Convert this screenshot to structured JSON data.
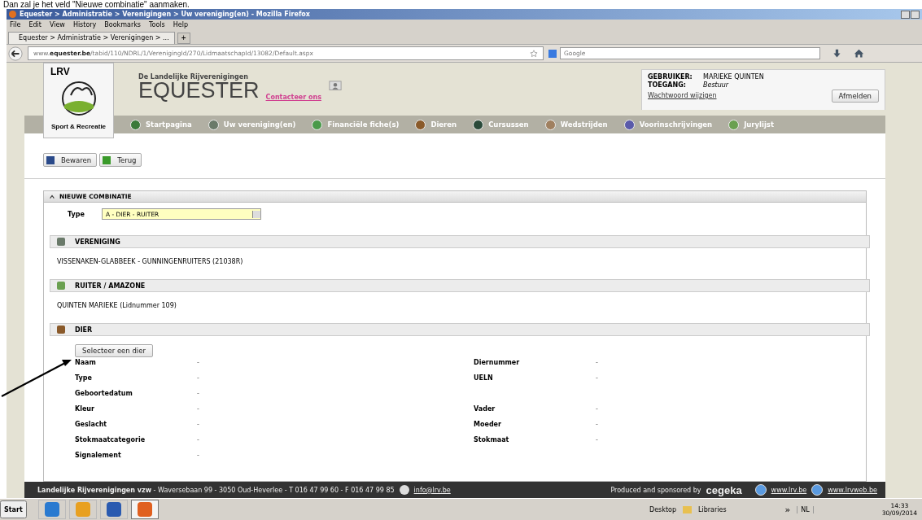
{
  "caption": "Dan zal je het veld \"Nieuwe combinatie\" aanmaken.",
  "window": {
    "title": "Equester > Administratie > Verenigingen > Uw vereniging(en) - Mozilla Firefox"
  },
  "menu": [
    "File",
    "Edit",
    "View",
    "History",
    "Bookmarks",
    "Tools",
    "Help"
  ],
  "tabs": [
    {
      "label": "Equester > Administratie > Verenigingen > ...",
      "selected": true
    }
  ],
  "new_tab": "+",
  "address": {
    "domain_prefix": "www.",
    "domain": "equester.be",
    "path": "/tabid/110/NDRL/1/VerenigingId/270/LidmaatschapId/13082/Default.aspx"
  },
  "search": {
    "placeholder": "Google"
  },
  "site": {
    "logo_text": "LRV",
    "logo_caption": "Sport & Recreatie",
    "subtitle": "De Landelijke Rijverenigingen",
    "title": "EQUESTER",
    "contact": "Contacteer ons"
  },
  "user": {
    "user_label": "GEBRUIKER:",
    "user_value": "MARIEKE QUINTEN",
    "access_label": "TOEGANG:",
    "access_value": "Bestuur",
    "password_link": "Wachtwoord wijzigen",
    "logout": "Afmelden"
  },
  "nav": [
    "Startpagina",
    "Uw vereniging(en)",
    "Financiële fiche(s)",
    "Dieren",
    "Cursussen",
    "Wedstrijden",
    "Voorinschrijvingen",
    "Jurylijst"
  ],
  "toolbar": [
    "Bewaren",
    "Terug"
  ],
  "panel": {
    "title": "NIEUWE COMBINATIE",
    "expanded": true,
    "type_label": "Type",
    "type_value": "A - DIER - RUITER"
  },
  "sections": [
    {
      "title": "VERENIGING",
      "text": "VISSENAKEN-GLABBEEK - GUNNINGENRUITERS (21038R)"
    },
    {
      "title": "RUITER / AMAZONE",
      "text": "QUINTEN MARIEKE (Lidnummer 109)"
    },
    {
      "title": "DIER",
      "button": "Selecteer een dier"
    }
  ],
  "animal_fields": [
    {
      "label": "Naam",
      "value": "-",
      "label_2": "Diernummer",
      "value_2": "-"
    },
    {
      "label": "Type",
      "value": "-",
      "label_2": "UELN",
      "value_2": "-"
    },
    {
      "label": "Geboortedatum",
      "value": "-"
    },
    {
      "label": "Kleur",
      "value": "-",
      "label_2": "Vader",
      "value_2": "-"
    },
    {
      "label": "Geslacht",
      "value": "-",
      "label_2": "Moeder",
      "value_2": "-"
    },
    {
      "label": "Stokmaatcategorie",
      "value": "-",
      "label_2": "Stokmaat",
      "value_2": "-"
    },
    {
      "label": "Signalement",
      "value": "-"
    }
  ],
  "footer": {
    "org": "Landelijke Rijverenigingen vzw",
    "address": " - Waversebaan 99 - 3050 Oud-Heverlee - T 016 47 99 60 - F 016 47 99 85",
    "email": "info@lrv.be",
    "sponsor_text": "Produced and sponsored by",
    "sponsor": "cegeka",
    "links": [
      "www.lrv.be",
      "www.lrvweb.be"
    ]
  },
  "taskbar": {
    "start": "Start",
    "apps": [
      {
        "selected": false
      },
      {
        "selected": false
      },
      {
        "selected": false
      },
      {
        "selected": true
      }
    ],
    "desktop": "Desktop",
    "libraries": "Libraries",
    "chevron": "»",
    "lang": "NL",
    "time": "14:33",
    "date": "30/09/2014"
  }
}
